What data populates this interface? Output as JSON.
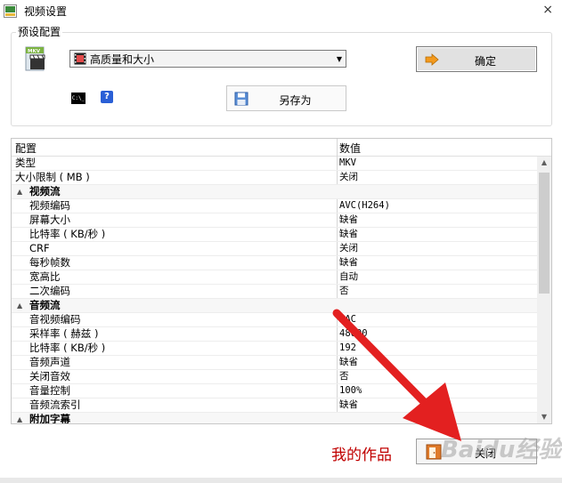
{
  "window": {
    "title": "视频设置",
    "close_glyph": "×"
  },
  "preset": {
    "group_title": "预设配置",
    "selected": "高质量和大小",
    "ok_label": "确定",
    "save_as_label": "另存为",
    "cmd_icon_text": "C:\\_",
    "help_icon_text": "?"
  },
  "grid": {
    "header": {
      "name": "配置",
      "value": "数值"
    },
    "rows": [
      {
        "name": "类型",
        "value": "MKV"
      },
      {
        "name": "大小限制 ( MB )",
        "value": "关闭"
      },
      {
        "name": "视频流",
        "value": "",
        "section": true
      },
      {
        "name": "视频编码",
        "value": "AVC(H264)"
      },
      {
        "name": "屏幕大小",
        "value": "缺省"
      },
      {
        "name": "比特率 ( KB/秒 )",
        "value": "缺省"
      },
      {
        "name": "CRF",
        "value": "关闭"
      },
      {
        "name": "每秒帧数",
        "value": "缺省"
      },
      {
        "name": "宽高比",
        "value": "自动"
      },
      {
        "name": "二次编码",
        "value": "否"
      },
      {
        "name": "音频流",
        "value": "",
        "section": true
      },
      {
        "name": "音视频编码",
        "value": "AAC"
      },
      {
        "name": "采样率 ( 赫兹 )",
        "value": "48000"
      },
      {
        "name": "比特率 ( KB/秒 )",
        "value": "192"
      },
      {
        "name": "音频声道",
        "value": "缺省"
      },
      {
        "name": "关闭音效",
        "value": "否"
      },
      {
        "name": "音量控制",
        "value": "100%"
      },
      {
        "name": "音频流索引",
        "value": "缺省"
      },
      {
        "name": "附加字幕",
        "value": "",
        "section": true
      }
    ]
  },
  "footer": {
    "caption": "我的作品",
    "close_label": "关闭",
    "watermark": "Baidu经验"
  },
  "colors": {
    "accent_red": "#e32020",
    "caption_red": "#c00000",
    "ok_arrow": "#f39a1e"
  }
}
